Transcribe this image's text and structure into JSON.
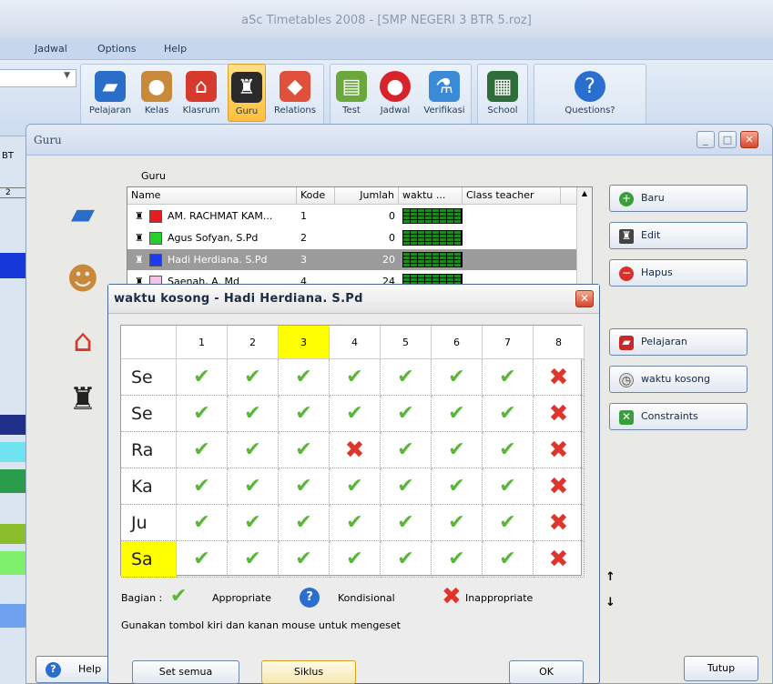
{
  "app": {
    "title": "aSc Timetables 2008  - [SMP NEGERI 3 BTR 5.roz]",
    "menu": [
      "Jadwal",
      "Options",
      "Help"
    ]
  },
  "ribbon": {
    "buttons": [
      {
        "label": "Pelajaran",
        "icon": "book-icon"
      },
      {
        "label": "Kelas",
        "icon": "students-icon"
      },
      {
        "label": "Klasrum",
        "icon": "house-icon"
      },
      {
        "label": "Guru",
        "icon": "teacher-icon",
        "active": true
      },
      {
        "label": "Relations",
        "icon": "relations-icon"
      },
      {
        "label": "Test",
        "icon": "test-icon"
      },
      {
        "label": "Jadwal",
        "icon": "timetable-icon"
      },
      {
        "label": "Verifikasi",
        "icon": "verify-icon"
      },
      {
        "label": "School",
        "icon": "school-icon"
      },
      {
        "label": "Questions?",
        "icon": "question-icon"
      }
    ]
  },
  "left_strip": {
    "label": "BT",
    "marker": "2"
  },
  "guru_window": {
    "title": "Guru",
    "table_label": "Guru",
    "columns": [
      "Name",
      "Kode",
      "Jumlah",
      "waktu ...",
      "Class teacher"
    ],
    "rows": [
      {
        "name": "AM. RACHMAT KAM...",
        "kode": "1",
        "jumlah": "0",
        "color": "#e81c1c",
        "selected": false
      },
      {
        "name": "Agus Sofyan, S.Pd",
        "kode": "2",
        "jumlah": "0",
        "color": "#22d22a",
        "selected": false
      },
      {
        "name": "Hadi Herdiana. S.Pd",
        "kode": "3",
        "jumlah": "20",
        "color": "#1c3cf0",
        "selected": true
      },
      {
        "name": "Saenah, A. Md",
        "kode": "4",
        "jumlah": "24",
        "color": "#f2c4e8",
        "selected": false
      }
    ],
    "side_buttons": [
      {
        "label": "Baru",
        "icon": "plus-icon"
      },
      {
        "label": "Edit",
        "icon": "edit-icon"
      },
      {
        "label": "Hapus",
        "icon": "minus-icon"
      },
      {
        "label": "Pelajaran",
        "icon": "subjects-icon"
      },
      {
        "label": "waktu kosong",
        "icon": "clock-icon"
      },
      {
        "label": "Constraints",
        "icon": "constraints-icon"
      }
    ],
    "help_label": "Help",
    "close_label": "Tutup"
  },
  "dialog": {
    "title": "waktu kosong - Hadi Herdiana. S.Pd",
    "periods": [
      "1",
      "2",
      "3",
      "4",
      "5",
      "6",
      "7",
      "8"
    ],
    "highlight_period": "3",
    "days": [
      "Se",
      "Se",
      "Ra",
      "Ka",
      "Ju",
      "Sa"
    ],
    "highlight_day": "Sa",
    "availability": [
      [
        "ok",
        "ok",
        "ok",
        "ok",
        "ok",
        "ok",
        "ok",
        "no"
      ],
      [
        "ok",
        "ok",
        "ok",
        "ok",
        "ok",
        "ok",
        "ok",
        "no"
      ],
      [
        "ok",
        "ok",
        "ok",
        "no",
        "ok",
        "ok",
        "ok",
        "no"
      ],
      [
        "ok",
        "ok",
        "ok",
        "ok",
        "ok",
        "ok",
        "ok",
        "no"
      ],
      [
        "ok",
        "ok",
        "ok",
        "ok",
        "ok",
        "ok",
        "ok",
        "no"
      ],
      [
        "ok",
        "ok",
        "ok",
        "ok",
        "ok",
        "ok",
        "ok",
        "no"
      ]
    ],
    "legend_label": "Bagian :",
    "legend": [
      "Appropriate",
      "Kondisional",
      "Inappropriate"
    ],
    "hint": "Gunakan tombol kiri dan kanan mouse untuk mengeset",
    "buttons": [
      "Set semua",
      "Siklus",
      "OK"
    ]
  },
  "colors": {
    "highlight": "#ffff00",
    "ok": "#58b83a",
    "no": "#e0332a"
  }
}
